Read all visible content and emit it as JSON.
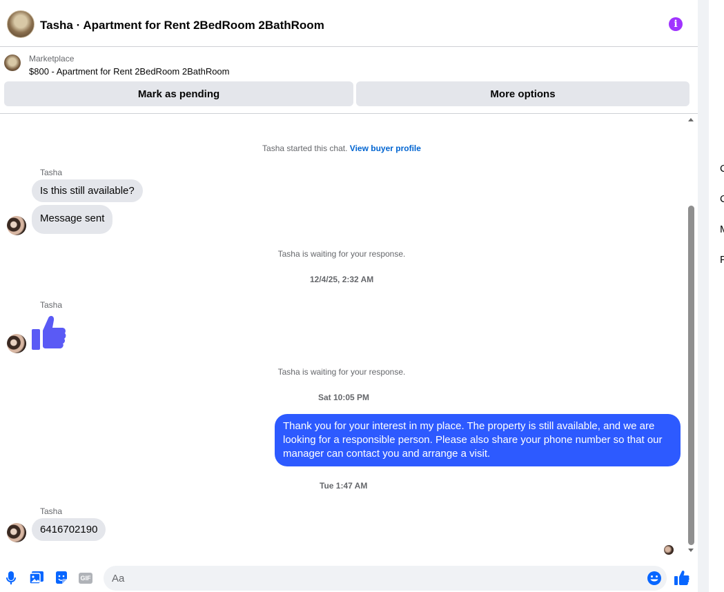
{
  "header": {
    "title": "Tasha · Apartment for Rent 2BedRoom 2BathRoom"
  },
  "marketplace": {
    "label": "Marketplace",
    "listing": "$800 - Apartment for Rent 2BedRoom 2BathRoom",
    "mark_pending": "Mark as pending",
    "more_options": "More options"
  },
  "messages": {
    "started_prefix": "Tasha started this chat. ",
    "view_buyer_profile": "View buyer profile",
    "sender_name": "Tasha",
    "msg1": "Is this still available?",
    "msg2": "Message sent",
    "waiting": "Tasha is waiting for your response.",
    "ts1": "12/4/25, 2:32 AM",
    "ts2": "Sat 10:05 PM",
    "outgoing": "Thank you for your interest in my place. The property is still available, and we are looking for a responsible person. Please also share your phone number so that our manager can contact you and arrange a visit.",
    "ts3": "Tue 1:47 AM",
    "phone": "6416702190"
  },
  "composer": {
    "placeholder": "Aa",
    "gif_label": "GIF"
  },
  "right_panel": {
    "letters": [
      "C",
      "C",
      "M",
      "P"
    ]
  },
  "colors": {
    "accent": "#0866ff",
    "outgoing_bubble": "#2d5aff",
    "info": "#a033ff",
    "thumb": "#5a5af5"
  }
}
